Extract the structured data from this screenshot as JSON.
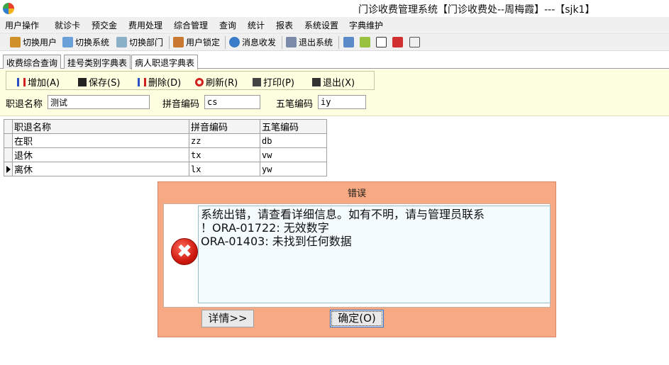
{
  "window": {
    "title": "门诊收费管理系统【门诊收费处--周梅霞】---【sjk1】"
  },
  "menu": [
    "用户操作",
    "就诊卡",
    "预交金",
    "费用处理",
    "综合管理",
    "查询",
    "统计",
    "报表",
    "系统设置",
    "字典维护"
  ],
  "toolbar": {
    "switch_user": "切换用户",
    "switch_system": "切换系统",
    "switch_dept": "切换部门",
    "lock_user": "用户锁定",
    "messages": "消息收发",
    "exit_system": "退出系统"
  },
  "tabs": [
    "收费综合查询",
    "挂号类别字典表",
    "病人职退字典表"
  ],
  "actions": {
    "add": "增加(A)",
    "save": "保存(S)",
    "delete": "删除(D)",
    "refresh": "刷新(R)",
    "print": "打印(P)",
    "exit": "退出(X)"
  },
  "form": {
    "name_label": "职退名称",
    "name_value": "测试",
    "pinyin_label": "拼音编码",
    "pinyin_value": "cs",
    "wubi_label": "五笔编码",
    "wubi_value": "iy"
  },
  "grid": {
    "headers": [
      "职退名称",
      "拼音编码",
      "五笔编码"
    ],
    "rows": [
      [
        "在职",
        "zz",
        "db"
      ],
      [
        "退休",
        "tx",
        "vw"
      ],
      [
        "离休",
        "lx",
        "yw"
      ]
    ]
  },
  "dialog": {
    "title": "错误",
    "lines": [
      "系统出错，请查看详细信息。如有不明，请与管理员联系",
      "！ORA-01722: 无效数字",
      "ORA-01403: 未找到任何数据"
    ],
    "details_label": "详情>>",
    "ok_label": "确定(O)"
  },
  "colors": {
    "dialog_bg": "#f6a983",
    "panel_bg": "#fefee0",
    "error_red": "#d01a10"
  },
  "icons": [
    "app-logo-icon",
    "switch-user-icon",
    "switch-system-icon",
    "switch-dept-icon",
    "lock-icon",
    "info-icon",
    "exit-icon",
    "edit-icon",
    "yen-icon",
    "checkbox-icon",
    "copy-icon",
    "document-icon",
    "add-icon",
    "save-icon",
    "delete-icon",
    "refresh-icon",
    "print-icon",
    "exit-door-icon",
    "error-icon",
    "row-pointer-icon"
  ]
}
